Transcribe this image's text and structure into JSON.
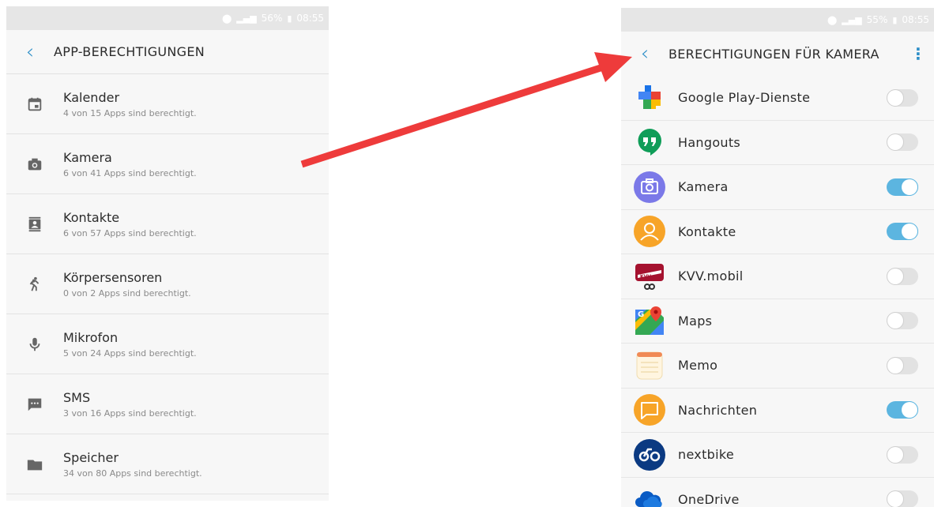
{
  "left": {
    "status": {
      "battery": "56%",
      "time": "08:55"
    },
    "title": "APP-BERECHTIGUNGEN",
    "items": [
      {
        "icon": "calendar-icon",
        "name": "Kalender",
        "sub": "4 von 15 Apps sind berechtigt."
      },
      {
        "icon": "camera-icon",
        "name": "Kamera",
        "sub": "6 von 41 Apps sind berechtigt."
      },
      {
        "icon": "contacts-icon",
        "name": "Kontakte",
        "sub": "6 von 57 Apps sind berechtigt."
      },
      {
        "icon": "body-sensors-icon",
        "name": "Körpersensoren",
        "sub": "0 von 2 Apps sind berechtigt."
      },
      {
        "icon": "microphone-icon",
        "name": "Mikrofon",
        "sub": "5 von 24 Apps sind berechtigt."
      },
      {
        "icon": "sms-icon",
        "name": "SMS",
        "sub": "3 von 16 Apps sind berechtigt."
      },
      {
        "icon": "folder-icon",
        "name": "Speicher",
        "sub": "34 von 80 Apps sind berechtigt."
      }
    ]
  },
  "right": {
    "status": {
      "battery": "55%",
      "time": "08:55"
    },
    "title": "BERECHTIGUNGEN FÜR KAMERA",
    "apps": [
      {
        "icon": "google-play-services-icon",
        "name": "Google Play-Dienste",
        "enabled": false
      },
      {
        "icon": "hangouts-icon",
        "name": "Hangouts",
        "enabled": false
      },
      {
        "icon": "samsung-camera-icon",
        "name": "Kamera",
        "enabled": true
      },
      {
        "icon": "samsung-contacts-icon",
        "name": "Kontakte",
        "enabled": true
      },
      {
        "icon": "kvv-mobil-icon",
        "name": "KVV.mobil",
        "enabled": false
      },
      {
        "icon": "google-maps-icon",
        "name": "Maps",
        "enabled": false
      },
      {
        "icon": "memo-icon",
        "name": "Memo",
        "enabled": false
      },
      {
        "icon": "samsung-messages-icon",
        "name": "Nachrichten",
        "enabled": true
      },
      {
        "icon": "nextbike-icon",
        "name": "nextbike",
        "enabled": false
      },
      {
        "icon": "onedrive-icon",
        "name": "OneDrive",
        "enabled": false
      }
    ]
  },
  "colors": {
    "accent": "#2c8ec8",
    "toggle_on": "#5cb5e0",
    "arrow": "#ee3b3b"
  }
}
